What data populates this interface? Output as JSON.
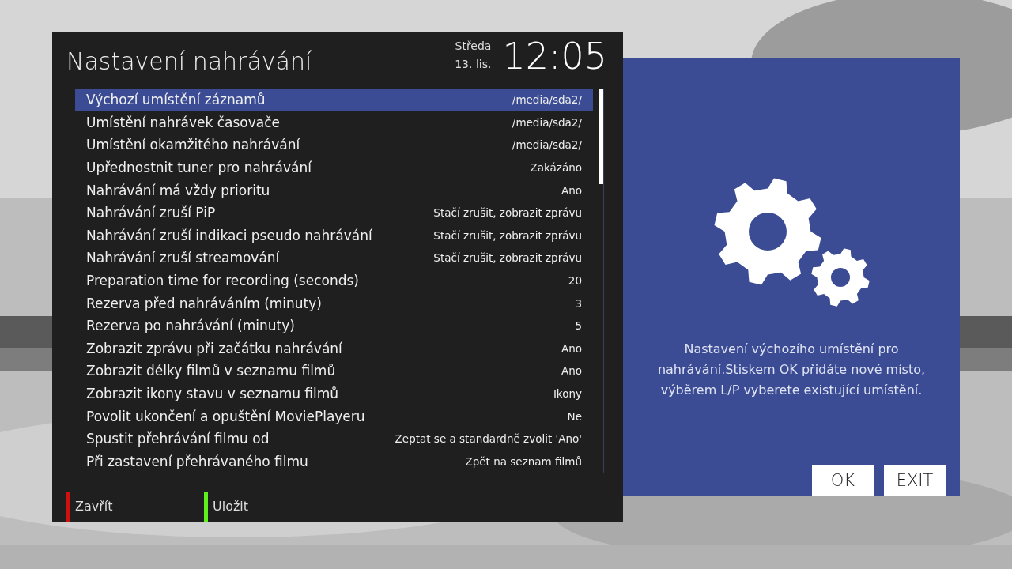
{
  "header": {
    "title": "Nastavení nahrávání",
    "weekday": "Středa",
    "date": "13. lis.",
    "time": "12:05"
  },
  "settings": [
    {
      "label": "Výchozí umístění záznamů",
      "value": "/media/sda2/",
      "selected": true
    },
    {
      "label": "Umístění nahrávek časovače",
      "value": "/media/sda2/",
      "selected": false
    },
    {
      "label": "Umístění okamžitého nahrávání",
      "value": "/media/sda2/",
      "selected": false
    },
    {
      "label": "Upřednostnit tuner pro nahrávání",
      "value": "Zakázáno",
      "selected": false
    },
    {
      "label": "Nahrávání má vždy prioritu",
      "value": "Ano",
      "selected": false
    },
    {
      "label": "Nahrávání zruší PiP",
      "value": "Stačí zrušit, zobrazit zprávu",
      "selected": false
    },
    {
      "label": "Nahrávání zruší indikaci pseudo nahrávání",
      "value": "Stačí zrušit, zobrazit zprávu",
      "selected": false
    },
    {
      "label": "Nahrávání zruší streamování",
      "value": "Stačí zrušit, zobrazit zprávu",
      "selected": false
    },
    {
      "label": "Preparation time for recording (seconds)",
      "value": "20",
      "selected": false
    },
    {
      "label": "Rezerva před nahráváním (minuty)",
      "value": "3",
      "selected": false
    },
    {
      "label": "Rezerva po nahrávání (minuty)",
      "value": "5",
      "selected": false
    },
    {
      "label": "Zobrazit zprávu při začátku nahrávání",
      "value": "Ano",
      "selected": false
    },
    {
      "label": "Zobrazit délky filmů v seznamu filmů",
      "value": "Ano",
      "selected": false
    },
    {
      "label": "Zobrazit ikony stavu v seznamu filmů",
      "value": "Ikony",
      "selected": false
    },
    {
      "label": "Povolit ukončení a opuštění MoviePlayeru",
      "value": "Ne",
      "selected": false
    },
    {
      "label": "Spustit přehrávání filmu od",
      "value": "Zeptat se a standardně zvolit 'Ano'",
      "selected": false
    },
    {
      "label": "Při zastavení přehrávaného filmu",
      "value": "Zpět na seznam filmů",
      "selected": false
    }
  ],
  "color_keys": [
    {
      "label": "Zavřít",
      "color": "#d0100f"
    },
    {
      "label": "Uložit",
      "color": "#5ef01c"
    }
  ],
  "help_panel": {
    "text": "Nastavení výchozího umístění pro nahrávání.Stiskem OK přidáte nové místo, výběrem L/P vyberete existující umístění.",
    "buttons": [
      "OK",
      "EXIT"
    ]
  }
}
